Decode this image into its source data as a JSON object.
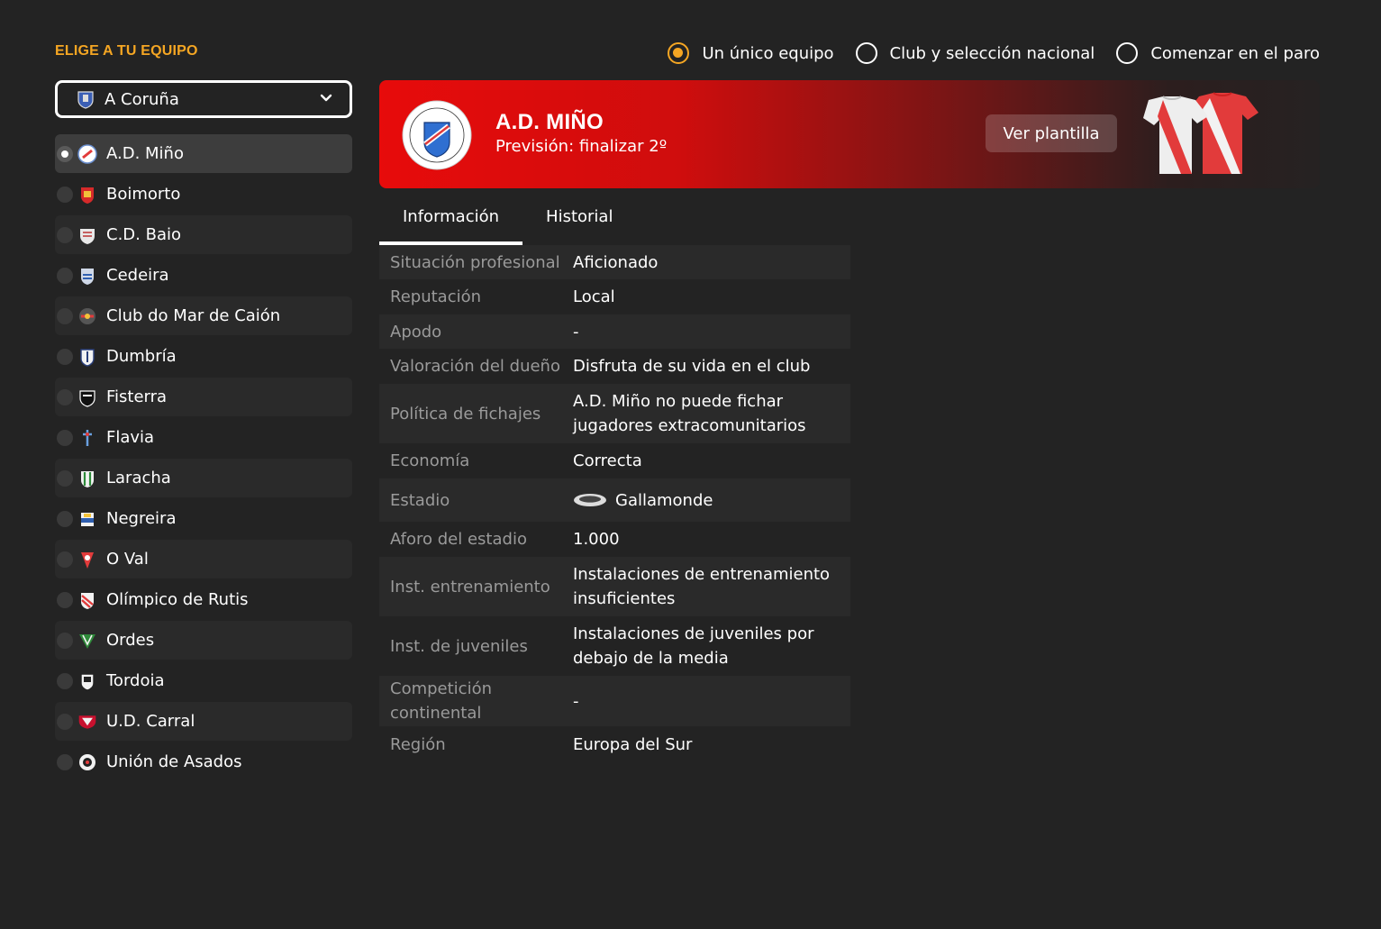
{
  "heading": "ELIGE A TU EQUIPO",
  "modes": [
    {
      "label": "Un único equipo",
      "selected": true
    },
    {
      "label": "Club y selección nacional",
      "selected": false
    },
    {
      "label": "Comenzar en el paro",
      "selected": false
    }
  ],
  "region_select": {
    "value": "A Coruña"
  },
  "teams": [
    {
      "name": "A.D. Miño",
      "selected": true
    },
    {
      "name": "Boimorto",
      "selected": false
    },
    {
      "name": "C.D. Baio",
      "selected": false
    },
    {
      "name": "Cedeira",
      "selected": false
    },
    {
      "name": "Club do Mar de Caión",
      "selected": false
    },
    {
      "name": "Dumbría",
      "selected": false
    },
    {
      "name": "Fisterra",
      "selected": false
    },
    {
      "name": "Flavia",
      "selected": false
    },
    {
      "name": "Laracha",
      "selected": false
    },
    {
      "name": "Negreira",
      "selected": false
    },
    {
      "name": "O Val",
      "selected": false
    },
    {
      "name": "Olímpico de Rutis",
      "selected": false
    },
    {
      "name": "Ordes",
      "selected": false
    },
    {
      "name": "Tordoia",
      "selected": false
    },
    {
      "name": "U.D. Carral",
      "selected": false
    },
    {
      "name": "Unión de Asados",
      "selected": false
    }
  ],
  "club": {
    "name": "A.D. MIÑO",
    "forecast": "Previsión: finalizar 2º",
    "squad_button": "Ver plantilla",
    "crest_text": "ASOCIACIÓN DEPORTIVA MIÑO 1985",
    "colors": {
      "primary": "#e70b0b",
      "kit_red": "#e23b3b",
      "kit_white": "#f2f2f2"
    }
  },
  "tabs": [
    {
      "label": "Información",
      "active": true
    },
    {
      "label": "Historial",
      "active": false
    }
  ],
  "info": [
    {
      "key": "Situación profesional",
      "value": "Aficionado"
    },
    {
      "key": "Reputación",
      "value": "Local"
    },
    {
      "key": "Apodo",
      "value": "-"
    },
    {
      "key": "Valoración del dueño",
      "value": "Disfruta de su vida en el club"
    },
    {
      "key": "Política de fichajes",
      "value": "A.D. Miño no puede fichar jugadores extracomunitarios"
    },
    {
      "key": "Economía",
      "value": "Correcta"
    },
    {
      "key": "Estadio",
      "value": "Gallamonde",
      "icon": "stadium-icon"
    },
    {
      "key": "Aforo del estadio",
      "value": "1.000"
    },
    {
      "key": "Inst. entrenamiento",
      "value": "Instalaciones de entrenamiento insuficientes"
    },
    {
      "key": "Inst. de juveniles",
      "value": "Instalaciones de juveniles por debajo de la media"
    },
    {
      "key": "Competición continental",
      "value": "-"
    },
    {
      "key": "Región",
      "value": "Europa del Sur"
    }
  ],
  "theme": {
    "accent": "#f5a623",
    "bg": "#232323",
    "row_alt": "#2a2a2a",
    "label_grey": "#9a9a9a"
  }
}
